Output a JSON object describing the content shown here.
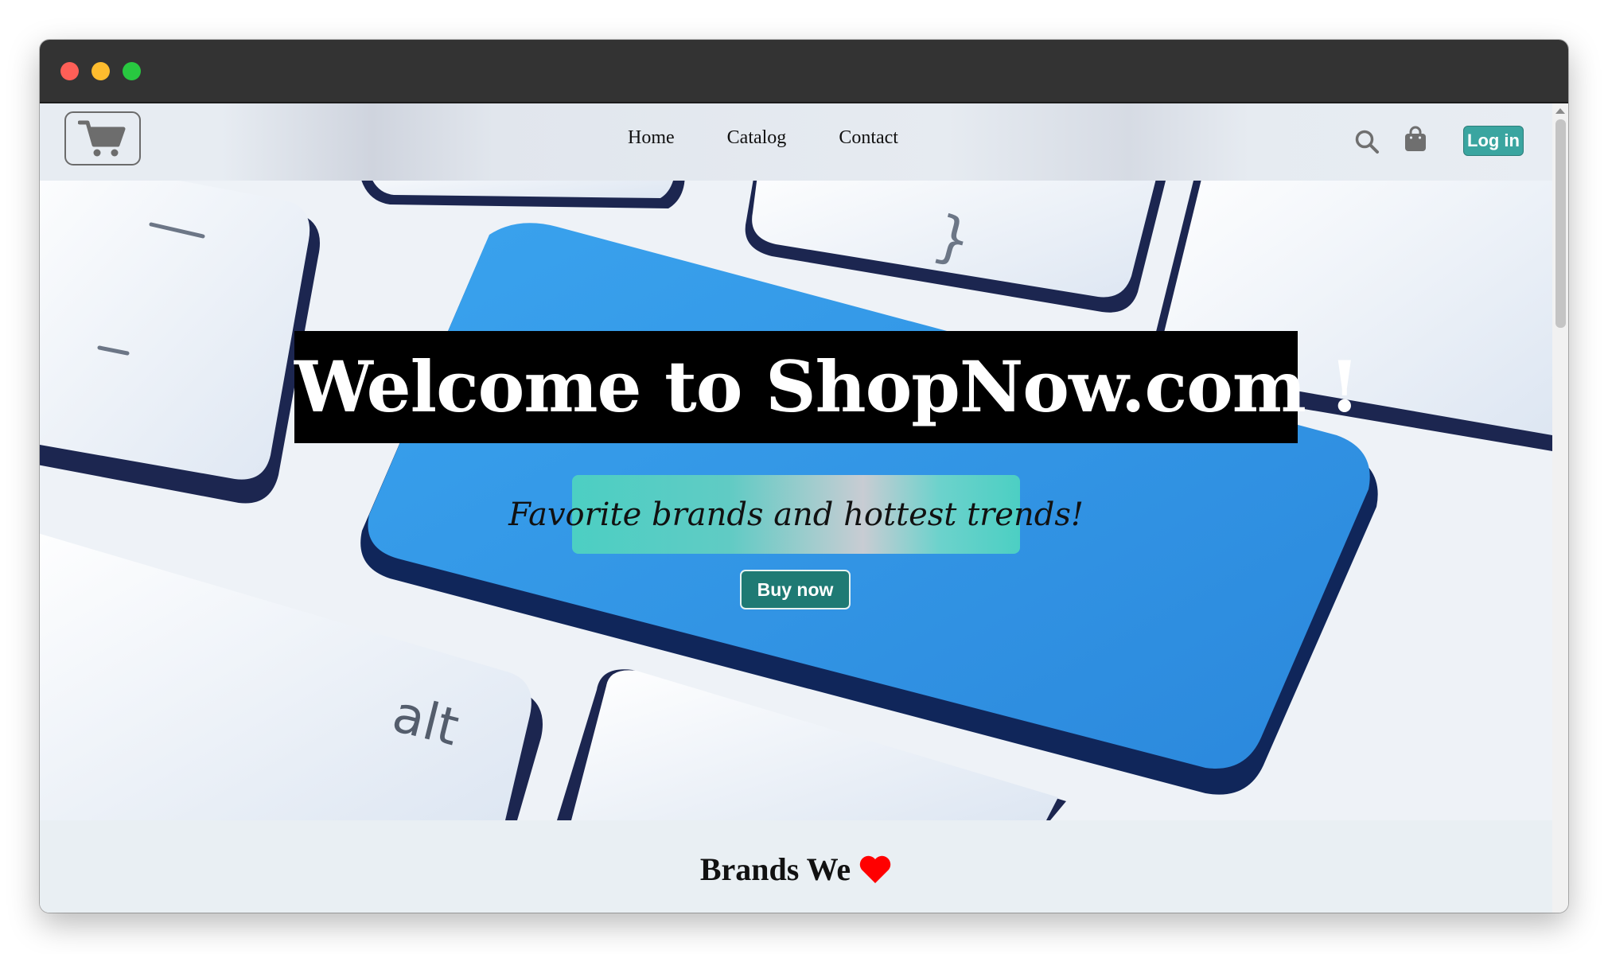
{
  "window": {
    "controls": [
      "close",
      "minimize",
      "zoom"
    ]
  },
  "navbar": {
    "logo_icon": "shopping-cart-icon",
    "links": [
      "Home",
      "Catalog",
      "Contact"
    ],
    "search_icon": "search-icon",
    "bag_icon": "shopping-bag-icon",
    "login_label": "Log in"
  },
  "hero": {
    "title": "Welcome to ShopNow.com !",
    "subtitle": "Favorite brands and hottest trends!",
    "cta_label": "Buy now",
    "background": "keyboard-with-shopping-cart-key-image"
  },
  "brands": {
    "heading": "Brands We",
    "heart_icon": "heart-icon"
  },
  "colors": {
    "accent": "#3aa5a0",
    "cta": "#1f7a74",
    "heart": "#ff0000",
    "key_blue": "#2f9be3"
  }
}
